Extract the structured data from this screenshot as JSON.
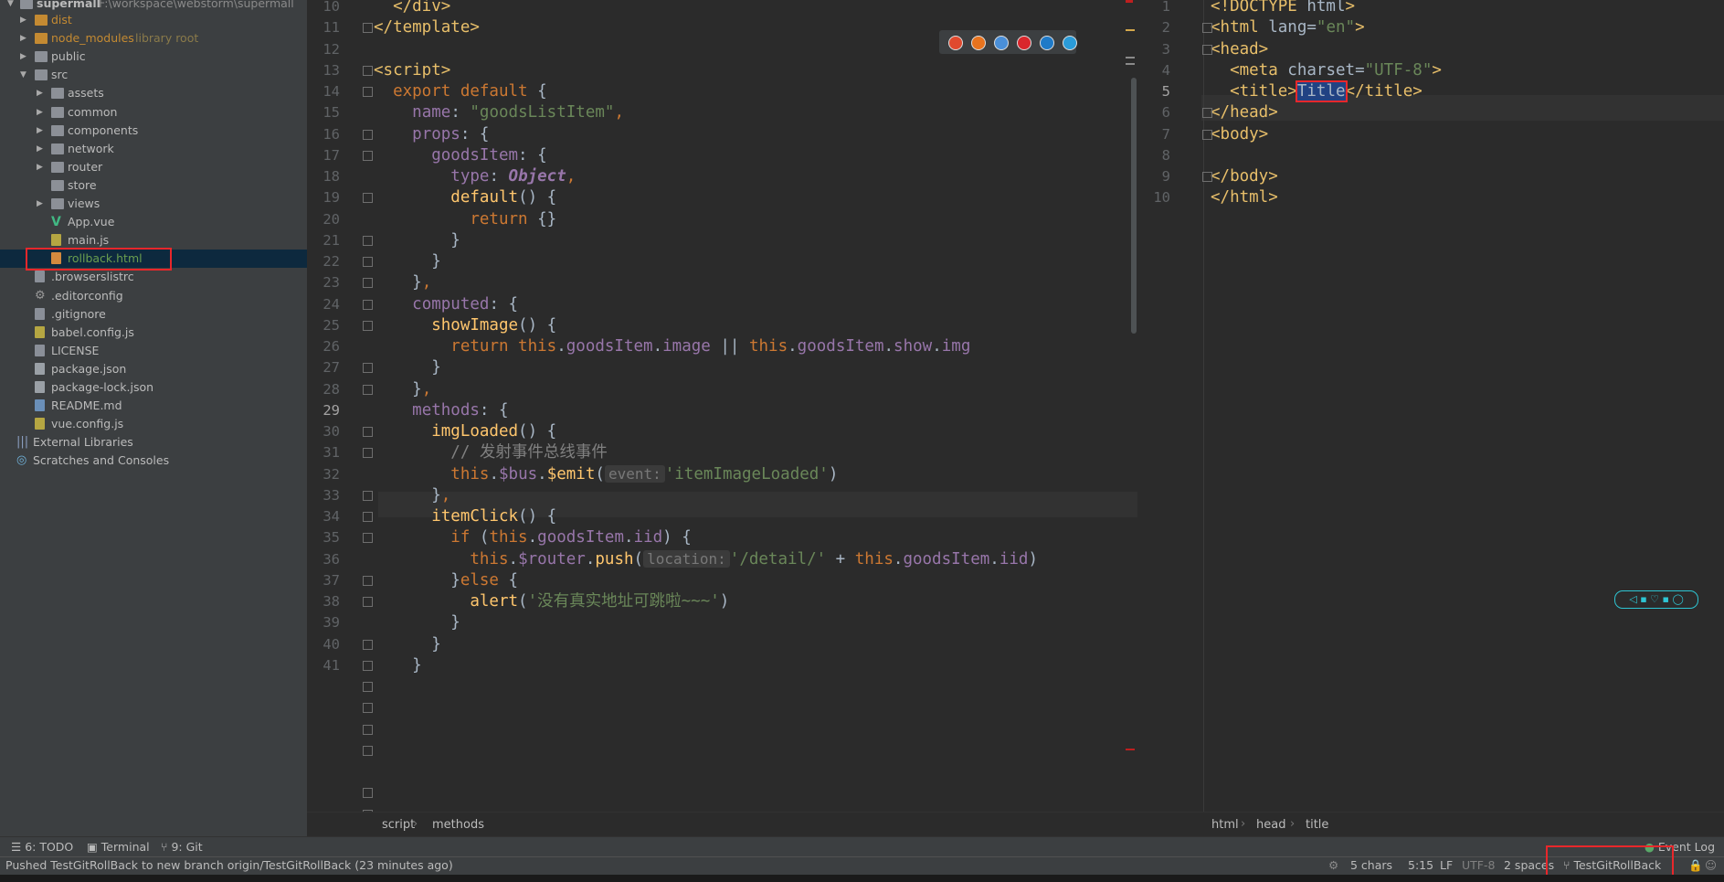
{
  "project_panel": {
    "root": {
      "name": "supermall",
      "path": "F:\\workspace\\webstorm\\supermall"
    },
    "items": [
      {
        "label": "dist",
        "type": "folder-excluded",
        "depth": 1,
        "expandable": true
      },
      {
        "label": "node_modules",
        "suffix": "library root",
        "type": "folder-excluded",
        "depth": 1,
        "expandable": true
      },
      {
        "label": "public",
        "type": "folder",
        "depth": 1,
        "expandable": true
      },
      {
        "label": "src",
        "type": "folder",
        "depth": 1,
        "expandable": true,
        "expanded": true
      },
      {
        "label": "assets",
        "type": "folder",
        "depth": 2,
        "expandable": true
      },
      {
        "label": "common",
        "type": "folder",
        "depth": 2,
        "expandable": true
      },
      {
        "label": "components",
        "type": "folder",
        "depth": 2,
        "expandable": true
      },
      {
        "label": "network",
        "type": "folder",
        "depth": 2,
        "expandable": true
      },
      {
        "label": "router",
        "type": "folder",
        "depth": 2,
        "expandable": true
      },
      {
        "label": "store",
        "type": "folder",
        "depth": 2,
        "expandable": false
      },
      {
        "label": "views",
        "type": "folder",
        "depth": 2,
        "expandable": true
      },
      {
        "label": "App.vue",
        "type": "vue",
        "depth": 2
      },
      {
        "label": "main.js",
        "type": "js",
        "depth": 2
      },
      {
        "label": "rollback.html",
        "type": "html",
        "depth": 2,
        "selected": true
      },
      {
        "label": ".browserslistrc",
        "type": "file",
        "depth": 1
      },
      {
        "label": ".editorconfig",
        "type": "gear",
        "depth": 1
      },
      {
        "label": ".gitignore",
        "type": "file",
        "depth": 1
      },
      {
        "label": "babel.config.js",
        "type": "js",
        "depth": 1
      },
      {
        "label": "LICENSE",
        "type": "file",
        "depth": 1
      },
      {
        "label": "package.json",
        "type": "json",
        "depth": 1
      },
      {
        "label": "package-lock.json",
        "type": "json",
        "depth": 1
      },
      {
        "label": "README.md",
        "type": "md",
        "depth": 1
      },
      {
        "label": "vue.config.js",
        "type": "js",
        "depth": 1
      },
      {
        "label": "External Libraries",
        "type": "library",
        "depth": 0
      },
      {
        "label": "Scratches and Consoles",
        "type": "scratch",
        "depth": 0
      }
    ]
  },
  "left_editor": {
    "lines": [
      {
        "n": "10",
        "tokens": [
          [
            "pl",
            "  "
          ],
          [
            "t",
            "</div>"
          ]
        ]
      },
      {
        "n": "11",
        "tokens": [
          [
            "t",
            "</template>"
          ]
        ]
      },
      {
        "n": "12",
        "tokens": []
      },
      {
        "n": "13",
        "tokens": [
          [
            "t",
            "<script>"
          ]
        ]
      },
      {
        "n": "14",
        "tokens": [
          [
            "pl",
            "  "
          ],
          [
            "k",
            "export default "
          ],
          [
            "pl",
            "{"
          ]
        ]
      },
      {
        "n": "15",
        "tokens": [
          [
            "pl",
            "    "
          ],
          [
            "p",
            "name"
          ],
          [
            "pl",
            ": "
          ],
          [
            "s",
            "\"goodsListItem\""
          ],
          [
            "k",
            ","
          ]
        ]
      },
      {
        "n": "16",
        "tokens": [
          [
            "pl",
            "    "
          ],
          [
            "p",
            "props"
          ],
          [
            "pl",
            ": {"
          ]
        ]
      },
      {
        "n": "17",
        "tokens": [
          [
            "pl",
            "      "
          ],
          [
            "p",
            "goodsItem"
          ],
          [
            "pl",
            ": {"
          ]
        ]
      },
      {
        "n": "18",
        "tokens": [
          [
            "pl",
            "        "
          ],
          [
            "p",
            "type"
          ],
          [
            "pl",
            ": "
          ],
          [
            "p",
            "Object"
          ],
          [
            "k",
            ","
          ]
        ]
      },
      {
        "n": "19",
        "tokens": [
          [
            "pl",
            "        "
          ],
          [
            "f",
            "default"
          ],
          [
            "pl",
            "() {"
          ]
        ]
      },
      {
        "n": "20",
        "tokens": [
          [
            "pl",
            "          "
          ],
          [
            "k",
            "return "
          ],
          [
            "pl",
            "{}"
          ]
        ]
      },
      {
        "n": "21",
        "tokens": [
          [
            "pl",
            "        }"
          ]
        ]
      },
      {
        "n": "22",
        "tokens": [
          [
            "pl",
            "      }"
          ]
        ]
      },
      {
        "n": "23",
        "tokens": [
          [
            "pl",
            "    }"
          ],
          [
            "k",
            ","
          ]
        ]
      },
      {
        "n": "24",
        "tokens": [
          [
            "pl",
            "    "
          ],
          [
            "p",
            "computed"
          ],
          [
            "pl",
            ": {"
          ]
        ]
      },
      {
        "n": "25",
        "tokens": [
          [
            "pl",
            "      "
          ],
          [
            "f",
            "showImage"
          ],
          [
            "pl",
            "() {"
          ]
        ]
      },
      {
        "n": "26",
        "tokens": [
          [
            "pl",
            "        "
          ],
          [
            "k",
            "return this"
          ],
          [
            "pl",
            "."
          ],
          [
            "p",
            "goodsItem"
          ],
          [
            "pl",
            "."
          ],
          [
            "p",
            "image"
          ],
          [
            "pl",
            " || "
          ],
          [
            "k",
            "this"
          ],
          [
            "pl",
            "."
          ],
          [
            "p",
            "goodsItem"
          ],
          [
            "pl",
            "."
          ],
          [
            "p",
            "show"
          ],
          [
            "pl",
            "."
          ],
          [
            "p",
            "img"
          ]
        ]
      },
      {
        "n": "27",
        "tokens": [
          [
            "pl",
            "      }"
          ]
        ]
      },
      {
        "n": "28",
        "tokens": [
          [
            "pl",
            "    }"
          ],
          [
            "k",
            ","
          ]
        ]
      },
      {
        "n": "29",
        "tokens": [
          [
            "pl",
            "    "
          ],
          [
            "p",
            "methods"
          ],
          [
            "pl",
            ": {"
          ]
        ]
      },
      {
        "n": "30",
        "tokens": [
          [
            "pl",
            "      "
          ],
          [
            "f",
            "imgLoaded"
          ],
          [
            "pl",
            "() {"
          ]
        ]
      },
      {
        "n": "31",
        "tokens": [
          [
            "pl",
            "        "
          ],
          [
            "c",
            "// 发射事件总线事件"
          ]
        ]
      },
      {
        "n": "32",
        "tokens": [
          [
            "pl",
            "        "
          ],
          [
            "k",
            "this"
          ],
          [
            "pl",
            "."
          ],
          [
            "p",
            "$bus"
          ],
          [
            "pl",
            "."
          ],
          [
            "f",
            "$emit"
          ],
          [
            "pl",
            "("
          ],
          [
            "hint",
            "event:"
          ],
          [
            "s",
            "'itemImageLoaded'"
          ],
          [
            "pl",
            ")"
          ]
        ]
      },
      {
        "n": "33",
        "tokens": [
          [
            "pl",
            "      }"
          ],
          [
            "k",
            ","
          ]
        ]
      },
      {
        "n": "34",
        "tokens": [
          [
            "pl",
            "      "
          ],
          [
            "f",
            "itemClick"
          ],
          [
            "pl",
            "() {"
          ]
        ]
      },
      {
        "n": "35",
        "tokens": [
          [
            "pl",
            "        "
          ],
          [
            "k",
            "if "
          ],
          [
            "pl",
            "("
          ],
          [
            "k",
            "this"
          ],
          [
            "pl",
            "."
          ],
          [
            "p",
            "goodsItem"
          ],
          [
            "pl",
            "."
          ],
          [
            "p",
            "iid"
          ],
          [
            "pl",
            ") {"
          ]
        ]
      },
      {
        "n": "36",
        "tokens": [
          [
            "pl",
            "          "
          ],
          [
            "k",
            "this"
          ],
          [
            "pl",
            "."
          ],
          [
            "p",
            "$router"
          ],
          [
            "pl",
            "."
          ],
          [
            "f",
            "push"
          ],
          [
            "pl",
            "("
          ],
          [
            "hint",
            "location:"
          ],
          [
            "s",
            "'/detail/'"
          ],
          [
            "pl",
            " + "
          ],
          [
            "k",
            "this"
          ],
          [
            "pl",
            "."
          ],
          [
            "p",
            "goodsItem"
          ],
          [
            "pl",
            "."
          ],
          [
            "p",
            "iid"
          ],
          [
            "pl",
            ")"
          ]
        ]
      },
      {
        "n": "37",
        "tokens": [
          [
            "pl",
            "        }"
          ],
          [
            "k",
            "else "
          ],
          [
            "pl",
            "{"
          ]
        ]
      },
      {
        "n": "38",
        "tokens": [
          [
            "pl",
            "          "
          ],
          [
            "f",
            "alert"
          ],
          [
            "pl",
            "("
          ],
          [
            "s",
            "'没有真实地址可跳啦~~~'"
          ],
          [
            "pl",
            ")"
          ]
        ]
      },
      {
        "n": "39",
        "tokens": [
          [
            "pl",
            "        }"
          ]
        ]
      },
      {
        "n": "40",
        "tokens": [
          [
            "pl",
            "      }"
          ]
        ]
      },
      {
        "n": "41",
        "tokens": [
          [
            "pl",
            "    }"
          ]
        ]
      }
    ],
    "breadcrumb": [
      "script",
      "methods"
    ],
    "browser_icons": [
      "chrome-icon",
      "firefox-icon",
      "safari-icon",
      "opera-icon",
      "ie-icon",
      "edge-icon"
    ]
  },
  "right_editor": {
    "lines": [
      {
        "n": "1",
        "tokens": [
          [
            "t",
            "<!DOCTYPE "
          ],
          [
            "pl",
            "html"
          ],
          [
            "t",
            ">"
          ]
        ]
      },
      {
        "n": "2",
        "tokens": [
          [
            "t",
            "<html "
          ],
          [
            "pl",
            "lang"
          ],
          [
            "pl",
            "="
          ],
          [
            "s",
            "\"en\""
          ],
          [
            "t",
            ">"
          ]
        ]
      },
      {
        "n": "3",
        "tokens": [
          [
            "t",
            "<head>"
          ]
        ]
      },
      {
        "n": "4",
        "tokens": [
          [
            "pl",
            "  "
          ],
          [
            "t",
            "<meta "
          ],
          [
            "pl",
            "charset"
          ],
          [
            "pl",
            "="
          ],
          [
            "s",
            "\"UTF-8\""
          ],
          [
            "t",
            ">"
          ]
        ]
      },
      {
        "n": "5",
        "tokens": [
          [
            "pl",
            "  "
          ],
          [
            "t",
            "<title>"
          ],
          [
            "sel",
            "Title"
          ],
          [
            "t",
            "</title>"
          ]
        ]
      },
      {
        "n": "6",
        "tokens": [
          [
            "t",
            "</head>"
          ]
        ]
      },
      {
        "n": "7",
        "tokens": [
          [
            "t",
            "<body>"
          ]
        ]
      },
      {
        "n": "8",
        "tokens": []
      },
      {
        "n": "9",
        "tokens": [
          [
            "t",
            "</body>"
          ]
        ]
      },
      {
        "n": "10",
        "tokens": [
          [
            "t",
            "</html>"
          ]
        ]
      }
    ],
    "breadcrumb": [
      "html",
      "head",
      "title"
    ]
  },
  "toolbar": {
    "todo": "6: TODO",
    "terminal": "Terminal",
    "git": "9: Git",
    "event_log": "Event Log"
  },
  "status": {
    "message": "Pushed TestGitRollBack to new branch origin/TestGitRollBack (23 minutes ago)",
    "chars": "5 chars",
    "position": "5:15",
    "line_sep": "LF",
    "encoding": "UTF-8",
    "indent": "2 spaces",
    "branch": "TestGitRollBack"
  },
  "colors": {
    "keyword": "#cc7832",
    "string": "#6a8759",
    "tag": "#e8bf6a",
    "property": "#9876aa",
    "function": "#ffc66d",
    "highlight_box": "#e8272b"
  }
}
